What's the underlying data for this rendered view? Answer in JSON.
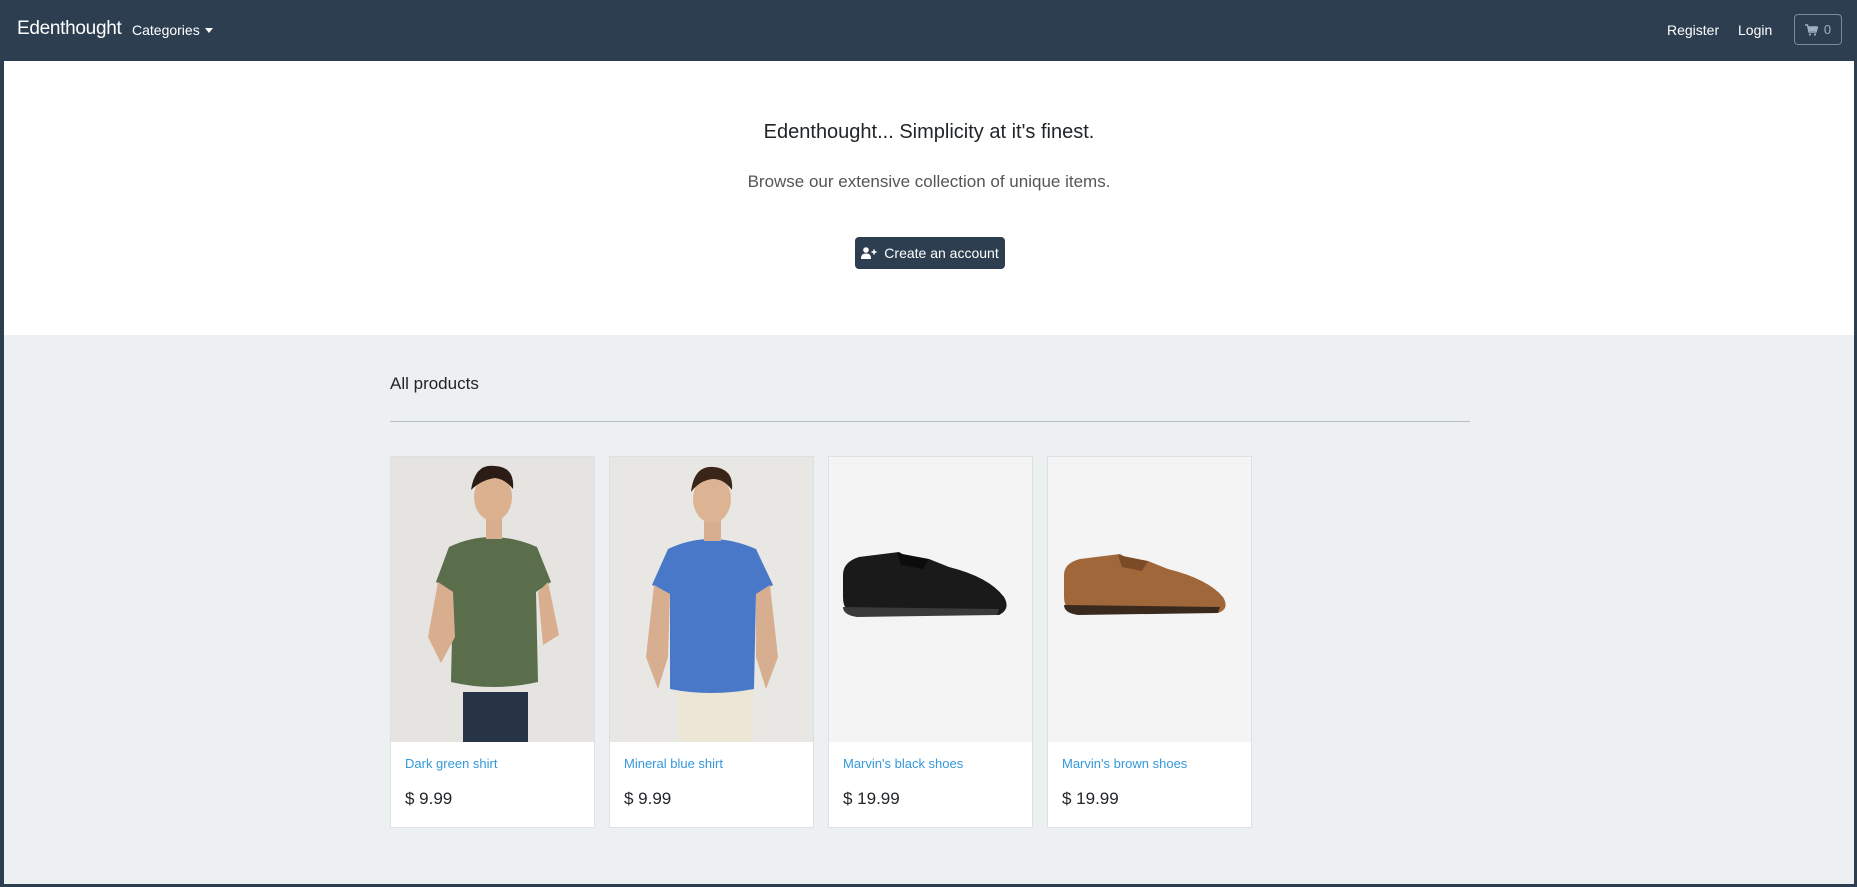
{
  "navbar": {
    "brand": "Edenthought",
    "categories_label": "Categories",
    "register_label": "Register",
    "login_label": "Login",
    "cart_count": "0"
  },
  "hero": {
    "title": "Edenthought... Simplicity at it's finest.",
    "subtitle": "Browse our extensive collection of unique items.",
    "cta_label": "Create an account"
  },
  "products_section": {
    "title": "All products",
    "items": [
      {
        "name": "Dark green shirt",
        "price": "$ 9.99"
      },
      {
        "name": "Mineral blue shirt",
        "price": "$ 9.99"
      },
      {
        "name": "Marvin's black shoes",
        "price": "$ 19.99"
      },
      {
        "name": "Marvin's brown shoes",
        "price": "$ 19.99"
      }
    ]
  },
  "colors": {
    "navbar": "#2c3e50",
    "page_bg": "#ecf0f1",
    "link": "#3498db"
  }
}
